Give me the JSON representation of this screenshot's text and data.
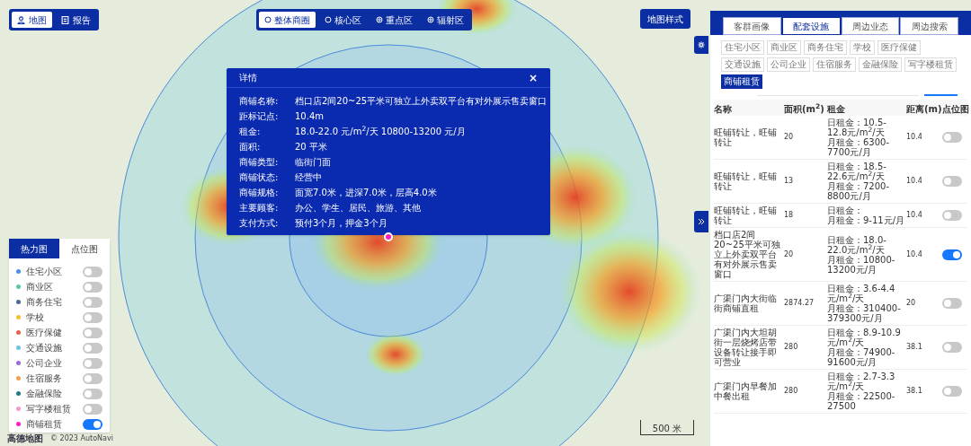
{
  "map_mode_tabs": [
    {
      "label": "地图",
      "selected": true
    },
    {
      "label": "报告",
      "selected": false
    }
  ],
  "range_tabs": [
    {
      "label": "整体商圈",
      "selected": true
    },
    {
      "label": "核心区",
      "selected": false
    },
    {
      "label": "重点区",
      "selected": false
    },
    {
      "label": "辐射区",
      "selected": false
    }
  ],
  "map_style_button": "地图样式",
  "detail_popup": {
    "title": "详情",
    "close": "×",
    "fields": [
      {
        "label": "商铺名称:",
        "value": "档口店2间20~25平米可独立上外卖双平台有对外展示售卖窗口"
      },
      {
        "label": "距标记点:",
        "value": "10.4m"
      },
      {
        "label": "租金:",
        "value": "18.0-22.0 元/m$^{2}$/天 10800-13200 元/月"
      },
      {
        "label": "面积:",
        "value": "20 平米"
      },
      {
        "label": "商铺类型:",
        "value": "临街门面"
      },
      {
        "label": "商铺状态:",
        "value": "经营中"
      },
      {
        "label": "商铺规格:",
        "value": "面宽7.0米，进深7.0米，层高4.0米"
      },
      {
        "label": "主要顾客:",
        "value": "办公、学生、居民、旅游、其他"
      },
      {
        "label": "支付方式:",
        "value": "预付3个月，押金3个月"
      }
    ]
  },
  "layer_panel": {
    "tabs": [
      {
        "label": "热力图",
        "selected": true
      },
      {
        "label": "点位图",
        "selected": false
      }
    ],
    "items": [
      {
        "label": "住宅小区",
        "color": "#4a90e2",
        "on": false
      },
      {
        "label": "商业区",
        "color": "#5cc99a",
        "on": false
      },
      {
        "label": "商务住宅",
        "color": "#4a6a9a",
        "on": false
      },
      {
        "label": "学校",
        "color": "#f2c12e",
        "on": false
      },
      {
        "label": "医疗保健",
        "color": "#e8604c",
        "on": false
      },
      {
        "label": "交通设施",
        "color": "#6cc3e8",
        "on": false
      },
      {
        "label": "公司企业",
        "color": "#9b6cd0",
        "on": false
      },
      {
        "label": "住宿服务",
        "color": "#f0a050",
        "on": false
      },
      {
        "label": "金融保险",
        "color": "#1f7a8a",
        "on": false
      },
      {
        "label": "写字楼租赁",
        "color": "#f59ad0",
        "on": false
      },
      {
        "label": "商铺租赁",
        "color": "#ff1fc8",
        "on": true
      }
    ]
  },
  "map_footer": {
    "logo": "高德地图",
    "copyright": "© 2023 AutoNavi",
    "scale": "500 米"
  },
  "side_panel": {
    "tabs": [
      {
        "label": "客群画像",
        "selected": false
      },
      {
        "label": "配套设施",
        "selected": true
      },
      {
        "label": "周边业态",
        "selected": false
      },
      {
        "label": "周边搜索",
        "selected": false
      }
    ],
    "categories": [
      {
        "label": "住宅小区",
        "selected": false
      },
      {
        "label": "商业区",
        "selected": false
      },
      {
        "label": "商务住宅",
        "selected": false
      },
      {
        "label": "学校",
        "selected": false
      },
      {
        "label": "医疗保健",
        "selected": false
      },
      {
        "label": "交通设施",
        "selected": false
      },
      {
        "label": "公司企业",
        "selected": false
      },
      {
        "label": "住宿服务",
        "selected": false
      },
      {
        "label": "金融保险",
        "selected": false
      },
      {
        "label": "写字楼租赁",
        "selected": false
      },
      {
        "label": "商铺租赁",
        "selected": true
      }
    ],
    "table": {
      "columns": [
        "名称",
        "面积(m$^{2}$)",
        "租金",
        "距离(m)",
        "点位图"
      ],
      "rows": [
        {
          "name": "旺铺转让，旺铺转让",
          "area": "20",
          "rent": [
            "日租金：10.5-12.8元/m$^{2}$/天",
            "月租金：6300-7700元/月"
          ],
          "distance": "10.4",
          "on": false
        },
        {
          "name": "旺铺转让，旺铺转让",
          "area": "13",
          "rent": [
            "日租金：18.5-22.6元/m$^{2}$/天",
            "月租金：7200-8800元/月"
          ],
          "distance": "10.4",
          "on": false
        },
        {
          "name": "旺铺转让，旺铺转让",
          "area": "18",
          "rent": [
            "日租金：",
            "月租金：9-11元/月"
          ],
          "distance": "10.4",
          "on": false
        },
        {
          "name": "档口店2间20~25平米可独立上外卖双平台有对外展示售卖窗口",
          "area": "20",
          "rent": [
            "日租金：18.0-22.0元/m$^{2}$/天",
            "月租金：10800-13200元/月"
          ],
          "distance": "10.4",
          "on": true
        },
        {
          "name": "广渠门内大街临街商铺直租",
          "area": "2874.27",
          "rent": [
            "日租金：3.6-4.4元/m$^{2}$/天",
            "月租金：310400-379300元/月"
          ],
          "distance": "20",
          "on": false
        },
        {
          "name": "广渠门内大坦胡街一层烧烤店带设备转让接手即可营业",
          "area": "280",
          "rent": [
            "日租金：8.9-10.9元/m$^{2}$/天",
            "月租金：74900-91600元/月"
          ],
          "distance": "38.1",
          "on": false
        },
        {
          "name": "广渠门内早餐加中餐出租",
          "area": "280",
          "rent": [
            "日租金：2.7-3.3元/m$^{2}$/天",
            "月租金：22500-27500"
          ],
          "distance": "38.1",
          "on": false
        }
      ]
    }
  }
}
